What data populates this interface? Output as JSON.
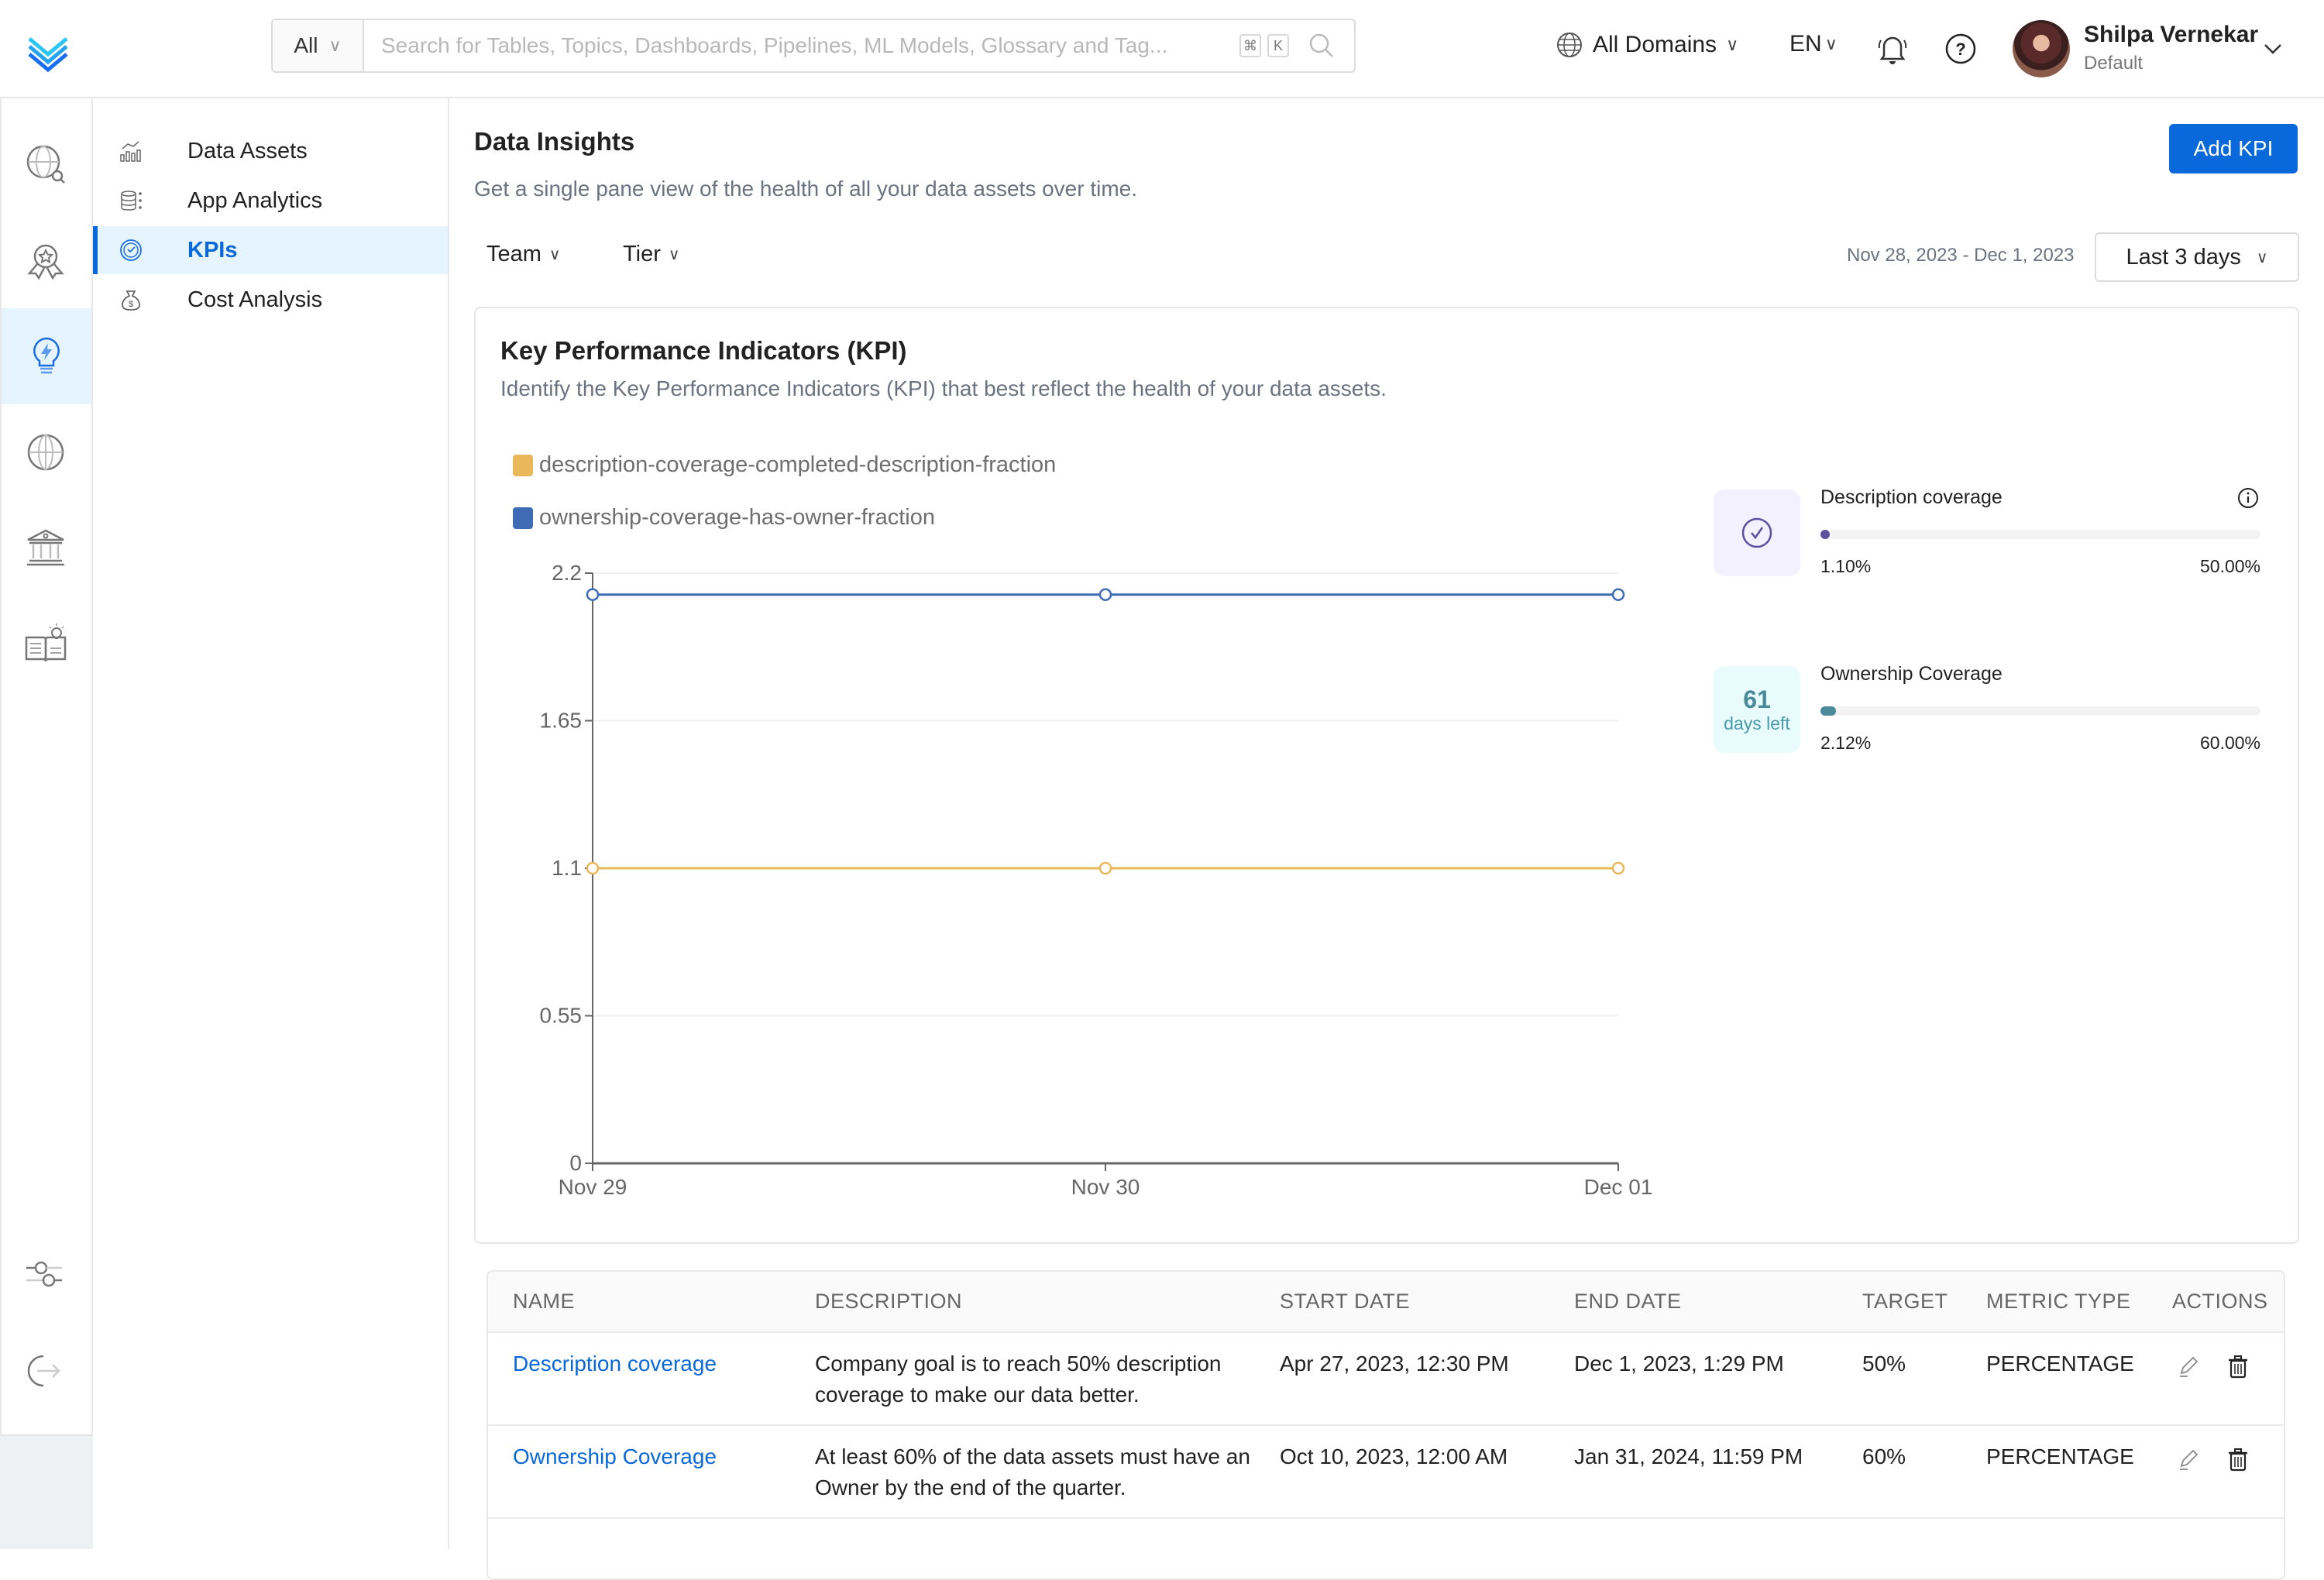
{
  "topbar": {
    "search_scope": "All",
    "search_placeholder": "Search for Tables, Topics, Dashboards, Pipelines, ML Models, Glossary and Tag...",
    "shortcut_keys": [
      "⌘",
      "K"
    ],
    "domain": "All Domains",
    "language": "EN",
    "user": {
      "name": "Shilpa Vernekar",
      "role": "Default"
    }
  },
  "rail": {
    "items": [
      {
        "icon": "explore-icon"
      },
      {
        "icon": "quality-badge-icon"
      },
      {
        "icon": "insights-bulb-icon",
        "active": true
      },
      {
        "icon": "domains-globe-icon"
      },
      {
        "icon": "governance-building-icon"
      },
      {
        "icon": "knowledge-book-icon"
      }
    ],
    "bottom_items": [
      {
        "icon": "settings-sliders-icon"
      },
      {
        "icon": "logout-icon"
      }
    ]
  },
  "subnav": {
    "items": [
      {
        "label": "Data Assets",
        "icon": "data-assets-icon"
      },
      {
        "label": "App Analytics",
        "icon": "app-analytics-icon"
      },
      {
        "label": "KPIs",
        "icon": "kpi-icon",
        "active": true
      },
      {
        "label": "Cost Analysis",
        "icon": "cost-analysis-icon"
      }
    ]
  },
  "main": {
    "title": "Data Insights",
    "subtitle": "Get a single pane view of the health of all your data assets over time.",
    "add_button": "Add KPI",
    "filters": {
      "team": "Team",
      "tier": "Tier"
    },
    "date_range": "Nov 28, 2023 - Dec 1, 2023",
    "range_select": "Last 3 days"
  },
  "kpi_card": {
    "title": "Key Performance Indicators (KPI)",
    "subtitle": "Identify the Key Performance Indicators (KPI) that best reflect the health of your data assets.",
    "progress": [
      {
        "name": "Description coverage",
        "current": "1.10%",
        "target": "50.00%",
        "fraction_of_target": 0.022,
        "color": "#5b4f9e",
        "tile": "check-circle"
      },
      {
        "name": "Ownership Coverage",
        "current": "2.12%",
        "target": "60.00%",
        "fraction_of_target": 0.035,
        "color": "#4a8a9a",
        "tile": "days-left",
        "days_left": "61",
        "days_label": "days left"
      }
    ]
  },
  "chart_data": {
    "type": "line",
    "title": "",
    "xlabel": "",
    "ylabel": "",
    "categories": [
      "Nov 29",
      "Nov 30",
      "Dec 01"
    ],
    "ylim": [
      0,
      2.2
    ],
    "yticks": [
      "0",
      "0.55",
      "1.1",
      "1.65",
      "2.2"
    ],
    "ytick_values": [
      0,
      0.55,
      1.1,
      1.65,
      2.2
    ],
    "grid": true,
    "legend_position": "top-left",
    "series": [
      {
        "name": "description-coverage-completed-description-fraction",
        "color": "#e8b85a",
        "values": [
          1.1,
          1.1,
          1.1
        ]
      },
      {
        "name": "ownership-coverage-has-owner-fraction",
        "color": "#3f6bb5",
        "values": [
          2.12,
          2.12,
          2.12
        ]
      }
    ]
  },
  "table": {
    "columns": [
      "NAME",
      "DESCRIPTION",
      "START DATE",
      "END DATE",
      "TARGET",
      "METRIC TYPE",
      "ACTIONS"
    ],
    "rows": [
      {
        "name": "Description coverage",
        "description": "Company goal is to reach 50% description coverage to make our data better.",
        "start": "Apr 27, 2023, 12:30 PM",
        "end": "Dec 1, 2023, 1:29 PM",
        "target": "50%",
        "metric": "PERCENTAGE"
      },
      {
        "name": "Ownership Coverage",
        "description": "At least 60% of the data assets must have an Owner by the end of the quarter.",
        "start": "Oct 10, 2023, 12:00 AM",
        "end": "Jan 31, 2024, 11:59 PM",
        "target": "60%",
        "metric": "PERCENTAGE"
      }
    ]
  },
  "colors": {
    "accent": "#0968da",
    "active_bg": "#e6f4ff"
  }
}
